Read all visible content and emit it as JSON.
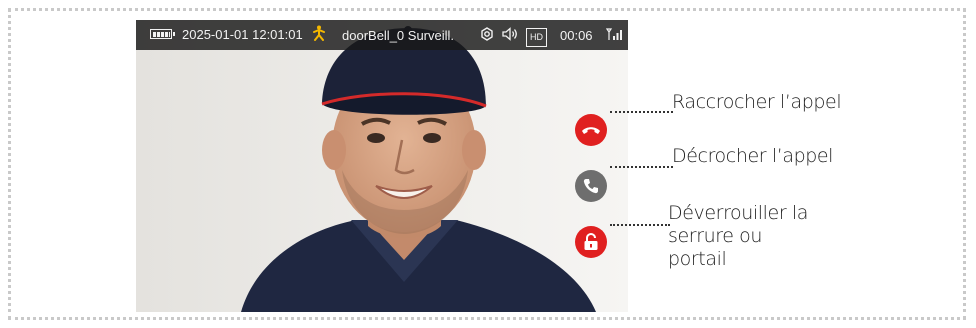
{
  "status_bar": {
    "datetime": "2025-01-01 12:01:01",
    "camera_name": "doorBell_0 Surveill.",
    "quality_badge": "HD",
    "duration": "00:06"
  },
  "controls": [
    {
      "label": "Raccrocher l’appel",
      "icon": "hang-up-icon",
      "color": "#e02020"
    },
    {
      "label": "Décrocher l’appel",
      "icon": "phone-icon",
      "color": "#6e6e6e"
    },
    {
      "label": "Déverrouiller la serrure ou portail",
      "icon": "unlock-icon",
      "color": "#e02020"
    }
  ],
  "colors": {
    "accent_red": "#e02020",
    "accent_grey": "#6e6e6e",
    "status_bg": "#191919",
    "motion_icon": "#f5b800"
  }
}
